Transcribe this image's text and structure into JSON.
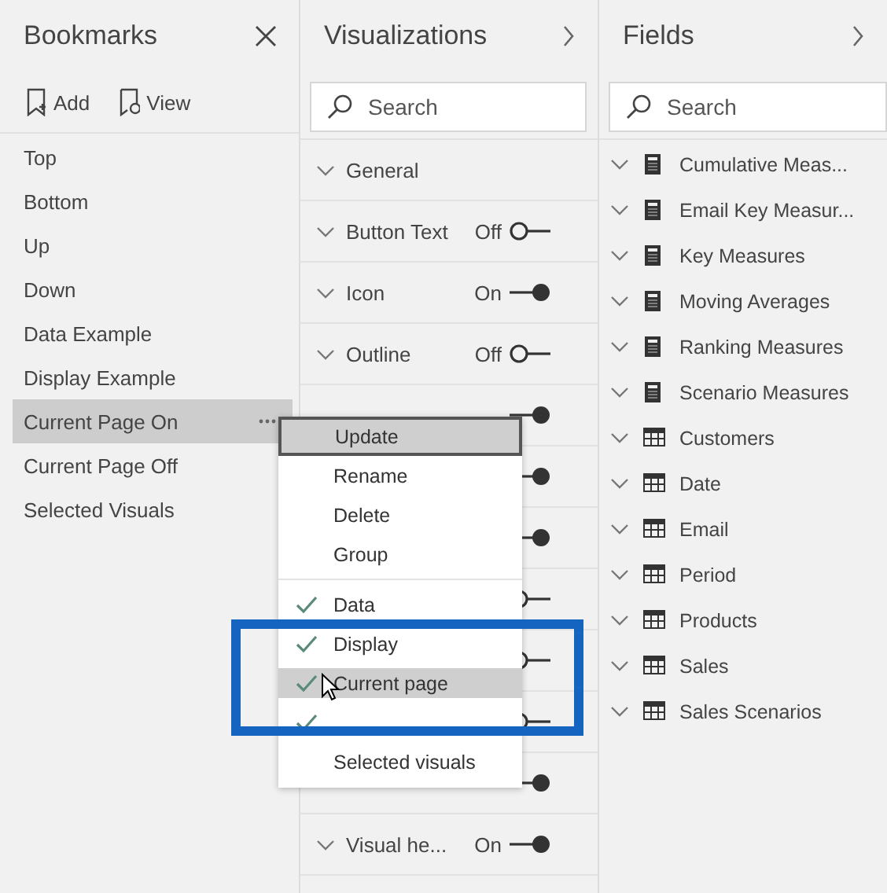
{
  "bookmarks": {
    "title": "Bookmarks",
    "toolbar": [
      {
        "label": "Add",
        "kind": "add"
      },
      {
        "label": "View",
        "kind": "view"
      }
    ],
    "items": [
      {
        "label": "Top",
        "selected": false
      },
      {
        "label": "Bottom",
        "selected": false
      },
      {
        "label": "Up",
        "selected": false
      },
      {
        "label": "Down",
        "selected": false
      },
      {
        "label": "Data Example",
        "selected": false
      },
      {
        "label": "Display Example",
        "selected": false
      },
      {
        "label": "Current Page On",
        "selected": true
      },
      {
        "label": "Current Page Off",
        "selected": false
      },
      {
        "label": "Selected Visuals",
        "selected": false
      }
    ]
  },
  "visualizations": {
    "title": "Visualizations",
    "search": {
      "placeholder": "Search"
    },
    "rows": [
      {
        "kind": "section",
        "label": "General"
      },
      {
        "kind": "toggle",
        "label": "Button Text",
        "state": "Off",
        "on": false
      },
      {
        "kind": "toggle",
        "label": "Icon",
        "state": "On",
        "on": true
      },
      {
        "kind": "toggle",
        "label": "Outline",
        "state": "Off",
        "on": false
      },
      {
        "kind": "toggle",
        "on": true
      },
      {
        "kind": "toggle",
        "on": true
      },
      {
        "kind": "toggle",
        "on": true
      },
      {
        "kind": "toggle",
        "on": false
      },
      {
        "kind": "toggle",
        "on": false
      },
      {
        "kind": "toggle",
        "on": false
      },
      {
        "kind": "toggle",
        "on": true
      },
      {
        "kind": "toggle",
        "label": "Visual he...",
        "state": "On",
        "on": true
      }
    ]
  },
  "fields": {
    "title": "Fields",
    "search": {
      "placeholder": "Search"
    },
    "items": [
      {
        "label": "Cumulative Meas...",
        "kind": "measure"
      },
      {
        "label": "Email Key Measur...",
        "kind": "measure"
      },
      {
        "label": "Key Measures",
        "kind": "measure"
      },
      {
        "label": "Moving Averages",
        "kind": "measure"
      },
      {
        "label": "Ranking Measures",
        "kind": "measure"
      },
      {
        "label": "Scenario Measures",
        "kind": "measure"
      },
      {
        "label": "Customers",
        "kind": "table"
      },
      {
        "label": "Date",
        "kind": "table"
      },
      {
        "label": "Email",
        "kind": "table"
      },
      {
        "label": "Period",
        "kind": "table"
      },
      {
        "label": "Products",
        "kind": "table"
      },
      {
        "label": "Sales",
        "kind": "table"
      },
      {
        "label": "Sales Scenarios",
        "kind": "table"
      }
    ]
  },
  "context_menu": {
    "items": [
      {
        "kind": "action",
        "label": "Update",
        "selected": true,
        "focused": true
      },
      {
        "kind": "action",
        "label": "Rename",
        "selected": false,
        "focused": false
      },
      {
        "kind": "action",
        "label": "Delete",
        "selected": false,
        "focused": false
      },
      {
        "kind": "action",
        "label": "Group",
        "selected": false,
        "focused": false
      },
      {
        "kind": "separator"
      },
      {
        "kind": "check",
        "label": "Data",
        "checked": true,
        "selected": false,
        "focused": false
      },
      {
        "kind": "check",
        "label": "Display",
        "checked": true,
        "selected": false,
        "focused": false
      },
      {
        "kind": "check",
        "label": "Current page",
        "checked": true,
        "selected": true,
        "focused": false
      },
      {
        "kind": "check",
        "checked": true,
        "selected": false,
        "focused": false
      },
      {
        "kind": "check",
        "label": "Selected visuals",
        "checked": false,
        "selected": false,
        "focused": false
      }
    ]
  }
}
